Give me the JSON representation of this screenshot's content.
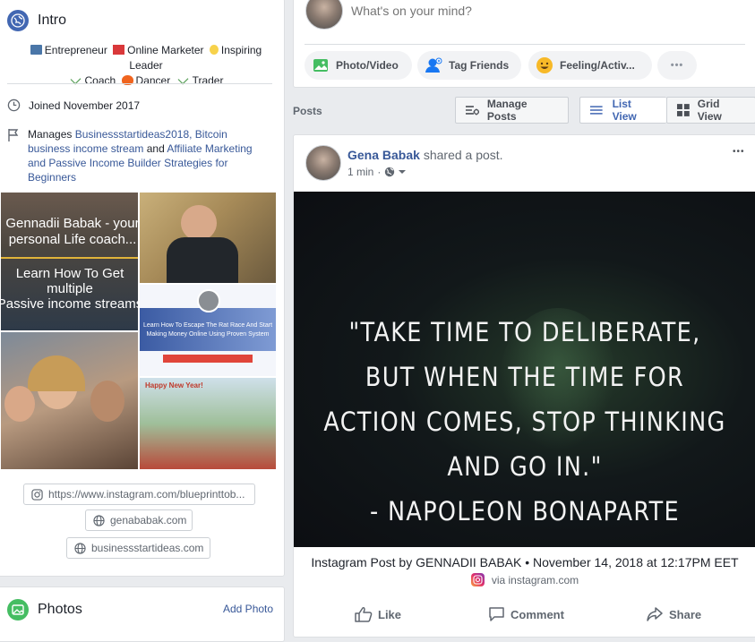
{
  "intro": {
    "title": "Intro",
    "tags": [
      "Entrepreneur",
      "Online Marketer",
      "Inspiring Leader",
      "Coach",
      "Dancer",
      "Trader"
    ],
    "joined": "Joined November 2017",
    "manages_prefix": "Manages ",
    "manages_link1": "Businessstartideas2018, Bitcoin business income stream",
    "manages_and": " and ",
    "manages_link2": "Affiliate Marketing and Passive Income Builder Strategies for Beginners",
    "photo1_line1": "Gennadii Babak - your",
    "photo1_line2": "personal Life coach...",
    "photo1_line3": "Learn How To Get",
    "photo1_line4": "multiple",
    "photo1_line5": "Passive income streams",
    "photo2_caption": "Learn How To Escape The Rat Race And Start",
    "photo2_caption2": "Making Money Online Using Proven System",
    "photo3_caption": "Happy New Year!",
    "links": [
      "https://www.instagram.com/blueprinttob...",
      "genababak.com",
      "businessstartideas.com"
    ]
  },
  "photos_section": {
    "title": "Photos",
    "add_label": "Add Photo"
  },
  "composer": {
    "placeholder": "What's on your mind?",
    "photo_video": "Photo/Video",
    "tag_friends": "Tag Friends",
    "feeling": "Feeling/Activ...",
    "more": "•••"
  },
  "posts_bar": {
    "label": "Posts",
    "manage": "Manage Posts",
    "list_view": "List View",
    "grid_view": "Grid View"
  },
  "post": {
    "author": "Gena Babak",
    "action": "shared a post.",
    "time": "1 min",
    "menu": "•••",
    "quote_lines": [
      "\"TAKE TIME TO DELIBERATE,",
      "BUT WHEN THE TIME FOR",
      "ACTION COMES, STOP THINKING",
      "AND GO IN.\"",
      "- NAPOLEON BONAPARTE"
    ],
    "caption": "Instagram Post by GENNADII BABAK • November 14, 2018 at 12:17PM EET",
    "via": "via instagram.com",
    "like": "Like",
    "comment": "Comment",
    "share": "Share"
  },
  "colors": {
    "brand_blue": "#385898",
    "link_blue": "#4267b2",
    "page_bg": "#e9ebee"
  }
}
